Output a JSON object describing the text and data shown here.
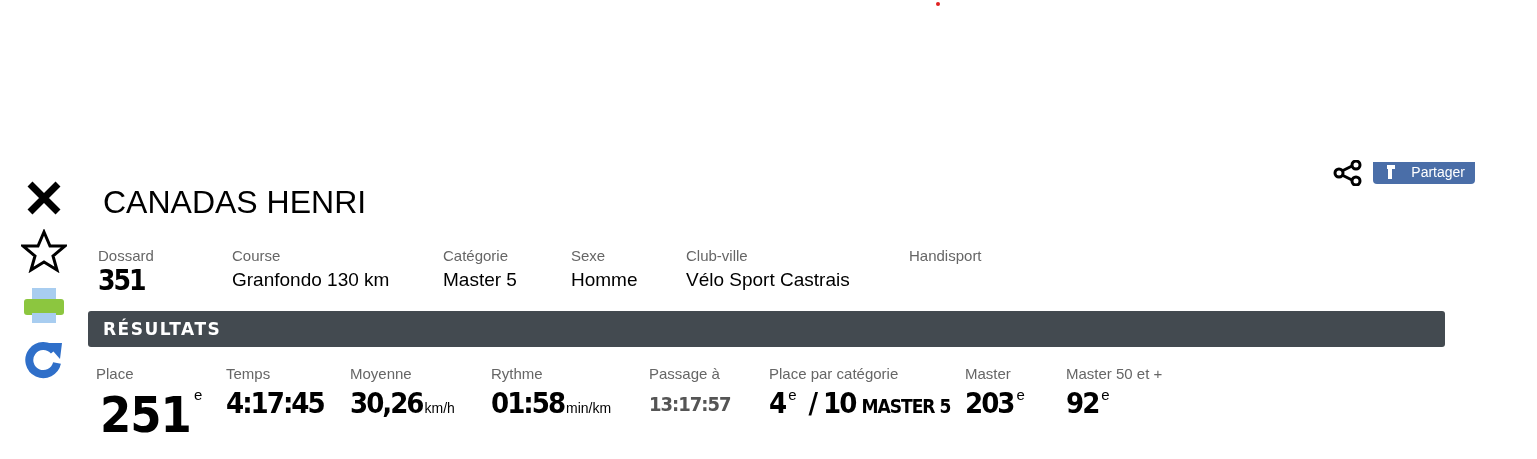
{
  "athlete": {
    "name": "CANADAS HENRI"
  },
  "share": {
    "label": "Partager"
  },
  "info": [
    {
      "label": "Dossard",
      "value": "351",
      "kind": "number"
    },
    {
      "label": "Course",
      "value": "Granfondo 130 km",
      "kind": "text"
    },
    {
      "label": "Catégorie",
      "value": "Master 5",
      "kind": "text"
    },
    {
      "label": "Sexe",
      "value": "Homme",
      "kind": "text"
    },
    {
      "label": "Club-ville",
      "value": "Vélo Sport Castrais",
      "kind": "text"
    },
    {
      "label": "Handisport",
      "kind": "empty"
    }
  ],
  "results": {
    "title": "RÉSULTATS",
    "items": [
      {
        "label": "Place",
        "kind": "big",
        "value": "251",
        "suffix": "e"
      },
      {
        "label": "Temps",
        "kind": "plain",
        "value": "4:17:45"
      },
      {
        "label": "Moyenne",
        "kind": "unit",
        "value": "30,26",
        "unit": "km/h"
      },
      {
        "label": "Rythme",
        "kind": "unit",
        "value": "01:58",
        "unit": "min/km"
      },
      {
        "label": "Passage à",
        "kind": "muted",
        "value": "13:17:57"
      },
      {
        "label": "Place par catégorie",
        "kind": "category",
        "value": "4",
        "suffix": "e",
        "total": "/ 10",
        "category": "MASTER 5"
      },
      {
        "label": "Master",
        "kind": "rank",
        "value": "203",
        "suffix": "e"
      },
      {
        "label": "Master 50 et +",
        "kind": "rank",
        "value": "92",
        "suffix": "e"
      }
    ]
  }
}
